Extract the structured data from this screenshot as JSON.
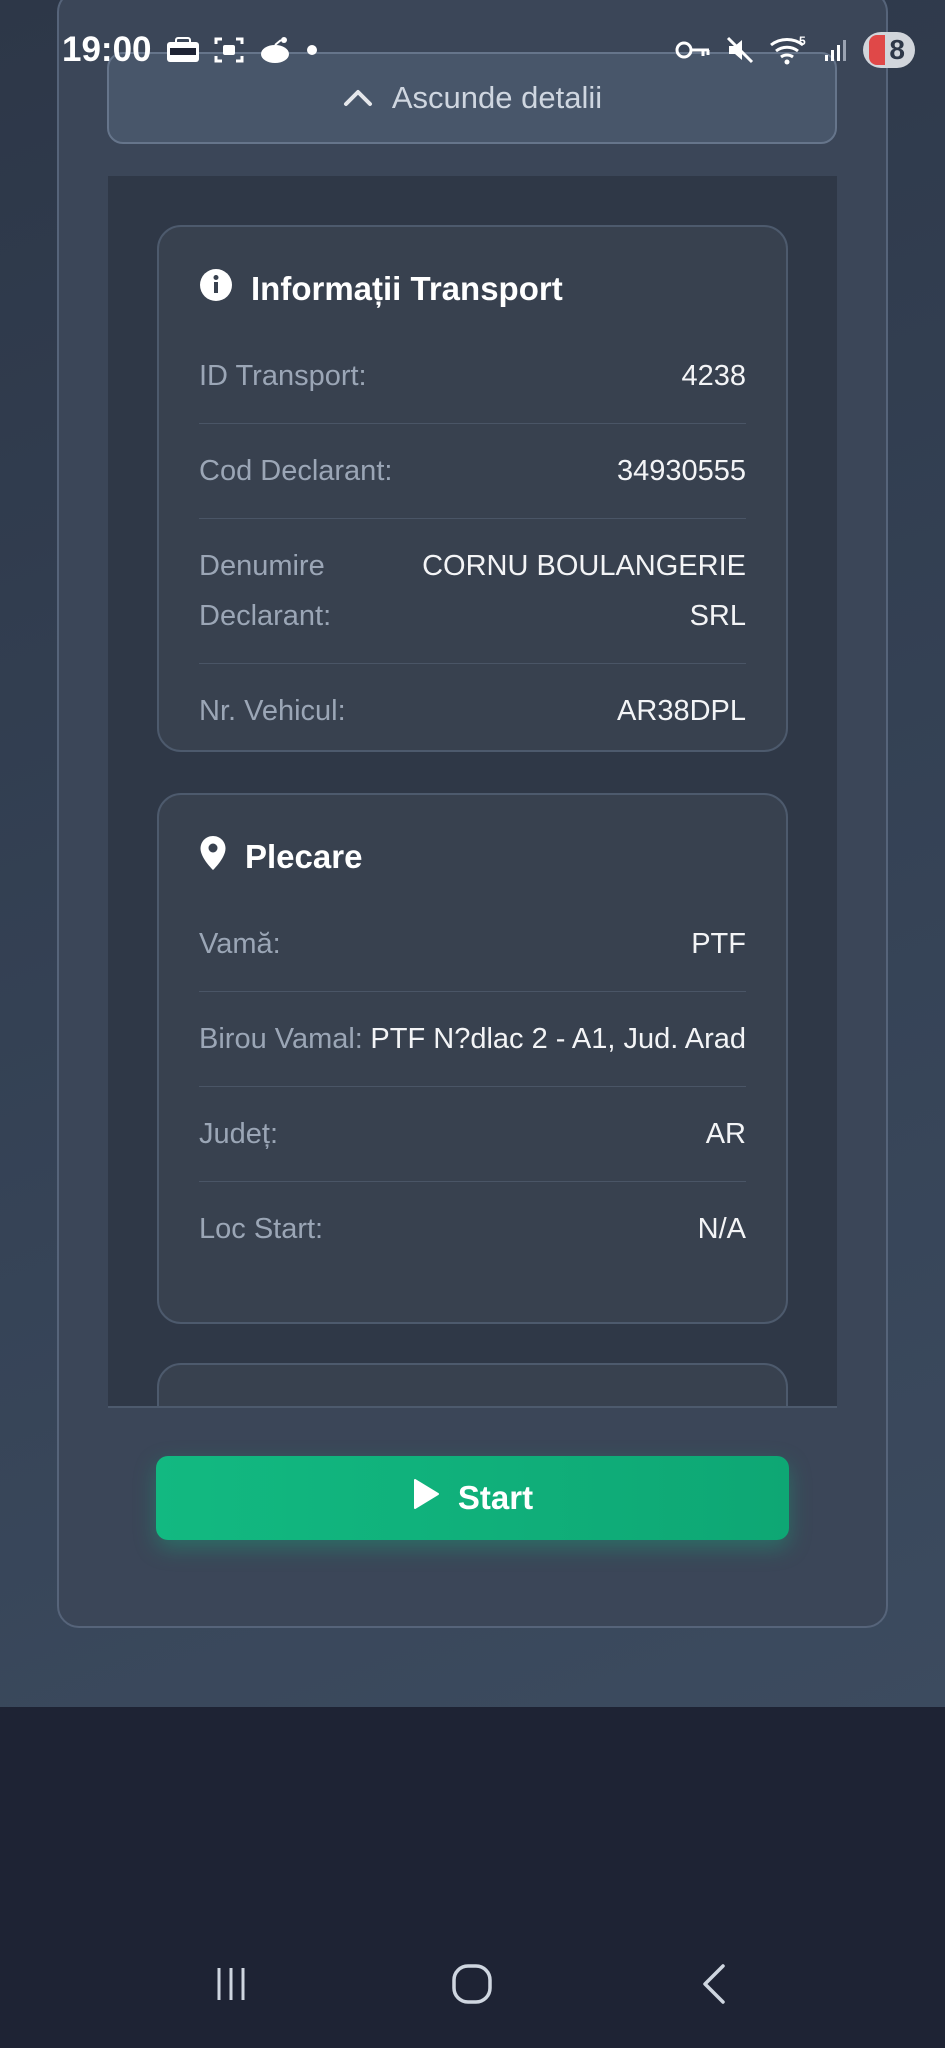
{
  "status_bar": {
    "time": "19:00",
    "battery": "8",
    "wifi_badge": "5"
  },
  "toggle": {
    "label": "Ascunde detalii"
  },
  "transport_card": {
    "title": "Informații Transport",
    "rows": [
      {
        "label": "ID Transport:",
        "value": "4238"
      },
      {
        "label": "Cod Declarant:",
        "value": "34930555"
      },
      {
        "label": "Denumire Declarant:",
        "value": "CORNU BOULANGERIE SRL"
      },
      {
        "label": "Nr. Vehicul:",
        "value": "AR38DPL"
      }
    ]
  },
  "departure_card": {
    "title": "Plecare",
    "rows": [
      {
        "label": "Vamă:",
        "value": "PTF"
      },
      {
        "label": "Birou Vamal:",
        "value": "PTF N?dlac 2 - A1, Jud. Arad"
      },
      {
        "label": "Județ:",
        "value": "AR"
      },
      {
        "label": "Loc Start:",
        "value": "N/A"
      }
    ]
  },
  "start_button": {
    "label": "Start"
  },
  "icons": {
    "info": "info-icon",
    "location": "location-pin-icon",
    "chevron": "chevron-up-icon",
    "play": "play-icon"
  },
  "colors": {
    "accent": "#10b981",
    "background": "#2d3748"
  }
}
